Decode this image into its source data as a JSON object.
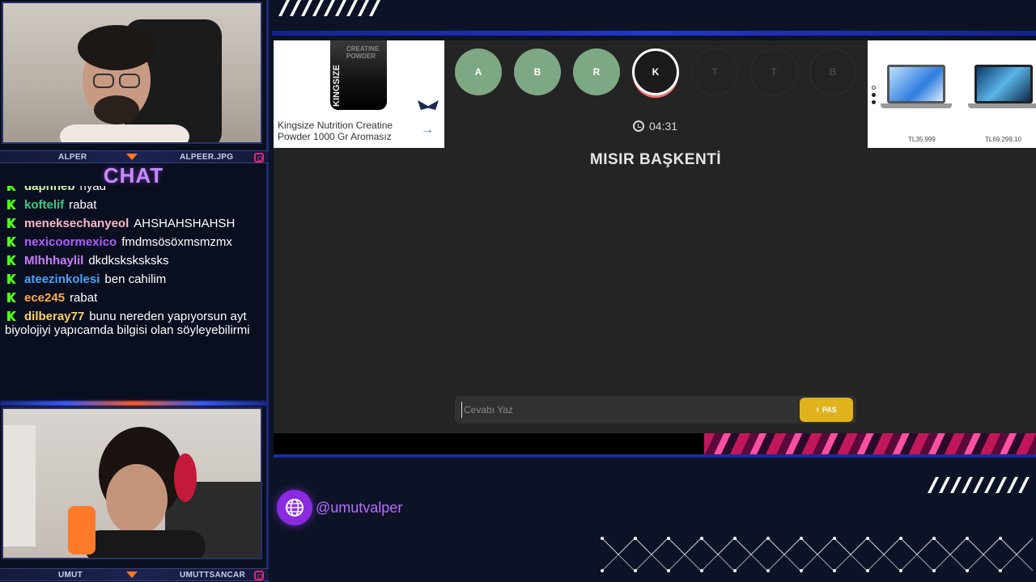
{
  "streamers": {
    "top": {
      "left_label": "ALPER",
      "right_label": "ALPEER.JPG"
    },
    "bottom": {
      "left_label": "UMUT",
      "right_label": "UMUTTSANCAR"
    }
  },
  "chat": {
    "title": "CHAT",
    "messages": [
      {
        "user": "daphneb",
        "color": "#c9f7b0",
        "text": "riyad"
      },
      {
        "user": "koftelif",
        "color": "#39c98a",
        "text": "rabat"
      },
      {
        "user": "meneksechanyeol",
        "color": "#ffb6c9",
        "text": "AHSHAHSHAHSH"
      },
      {
        "user": "nexicoormexico",
        "color": "#b05cff",
        "text": "fmdmsösöxmsmzmx"
      },
      {
        "user": "Mlhhhaylil",
        "color": "#c77dff",
        "text": "dkdksksksksks"
      },
      {
        "user": "ateezinkolesi",
        "color": "#4aa3ff",
        "text": "ben cahilim"
      },
      {
        "user": "ece245",
        "color": "#ffa94d",
        "text": "rabat"
      },
      {
        "user": "dilberay77",
        "color": "#ffd35c",
        "text": "bunu nereden yapıyorsun ayt biyolojiyi yapıcamda bilgisi olan söyleyebilirmi"
      }
    ]
  },
  "ads": {
    "left": {
      "product_text": "CREATINE POWDER",
      "product_brand": "KINGSIZE",
      "title": "Kingsize Nutrition Creatine Powder 1000 Gr Aromasız",
      "arrow": "→"
    },
    "right": {
      "price1": "TL35.999",
      "price2": "TL69.299,10"
    }
  },
  "game": {
    "letters": [
      {
        "letter": "A",
        "state": "done"
      },
      {
        "letter": "B",
        "state": "done"
      },
      {
        "letter": "R",
        "state": "done"
      },
      {
        "letter": "K",
        "state": "active"
      },
      {
        "letter": "T",
        "state": "pending"
      },
      {
        "letter": "T",
        "state": "pending"
      },
      {
        "letter": "B",
        "state": "pending"
      }
    ],
    "timer": "04:31",
    "question": "MISIR BAŞKENTİ",
    "answer_placeholder": "Cevabı Yaz",
    "pass_label": "PAS",
    "pass_chevron": "›"
  },
  "social": {
    "handle": "@umutvalper"
  },
  "colors": {
    "accent_purple": "#8b2be0",
    "pass_yellow": "#e0b21e",
    "done_green": "#7ea883",
    "kick_green": "#53fc18"
  }
}
